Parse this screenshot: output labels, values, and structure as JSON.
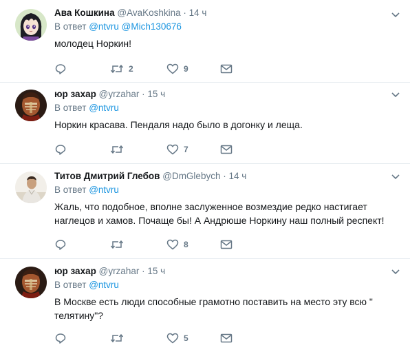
{
  "tweets": [
    {
      "name": "Ава Кошкина",
      "handle": "@AvaKoshkina",
      "separator": "·",
      "time": "14 ч",
      "reply_prefix": "В ответ",
      "mentions": [
        "@ntvru",
        "@Mich130676"
      ],
      "text": "молодец Норкин!",
      "retweets": "2",
      "likes": "9",
      "avatar_icon": "anime-avatar"
    },
    {
      "name": "юр захар",
      "handle": "@yrzahar",
      "separator": "·",
      "time": "15 ч",
      "reply_prefix": "В ответ",
      "mentions": [
        "@ntvru"
      ],
      "text": "Норкин красава. Пендаля надо было в догонку и леща.",
      "retweets": "",
      "likes": "7",
      "avatar_icon": "portrait-avatar"
    },
    {
      "name": "Титов Дмитрий Глебов",
      "handle": "@DmGlebych",
      "separator": "·",
      "time": "14 ч",
      "reply_prefix": "В ответ",
      "mentions": [
        "@ntvru"
      ],
      "text_lines": [
        "Жаль, что подобное, вполне заслуженное  возмездие редко настигает",
        "наглецов и хамов. Почаще бы! А Андрюше Норкину наш полный респект!"
      ],
      "retweets": "",
      "likes": "8",
      "avatar_icon": "photo-avatar"
    },
    {
      "name": "юр захар",
      "handle": "@yrzahar",
      "separator": "·",
      "time": "15 ч",
      "reply_prefix": "В ответ",
      "mentions": [
        "@ntvru"
      ],
      "text_lines": [
        "В Москве есть люди способные грамотно поставить на место эту всю \"",
        "телятину\"?"
      ],
      "retweets": "",
      "likes": "5",
      "avatar_icon": "portrait-avatar"
    }
  ],
  "colors": {
    "link": "#1b95e0",
    "secondary": "#657786",
    "text": "#14171a",
    "divider": "#e6ecf0"
  }
}
